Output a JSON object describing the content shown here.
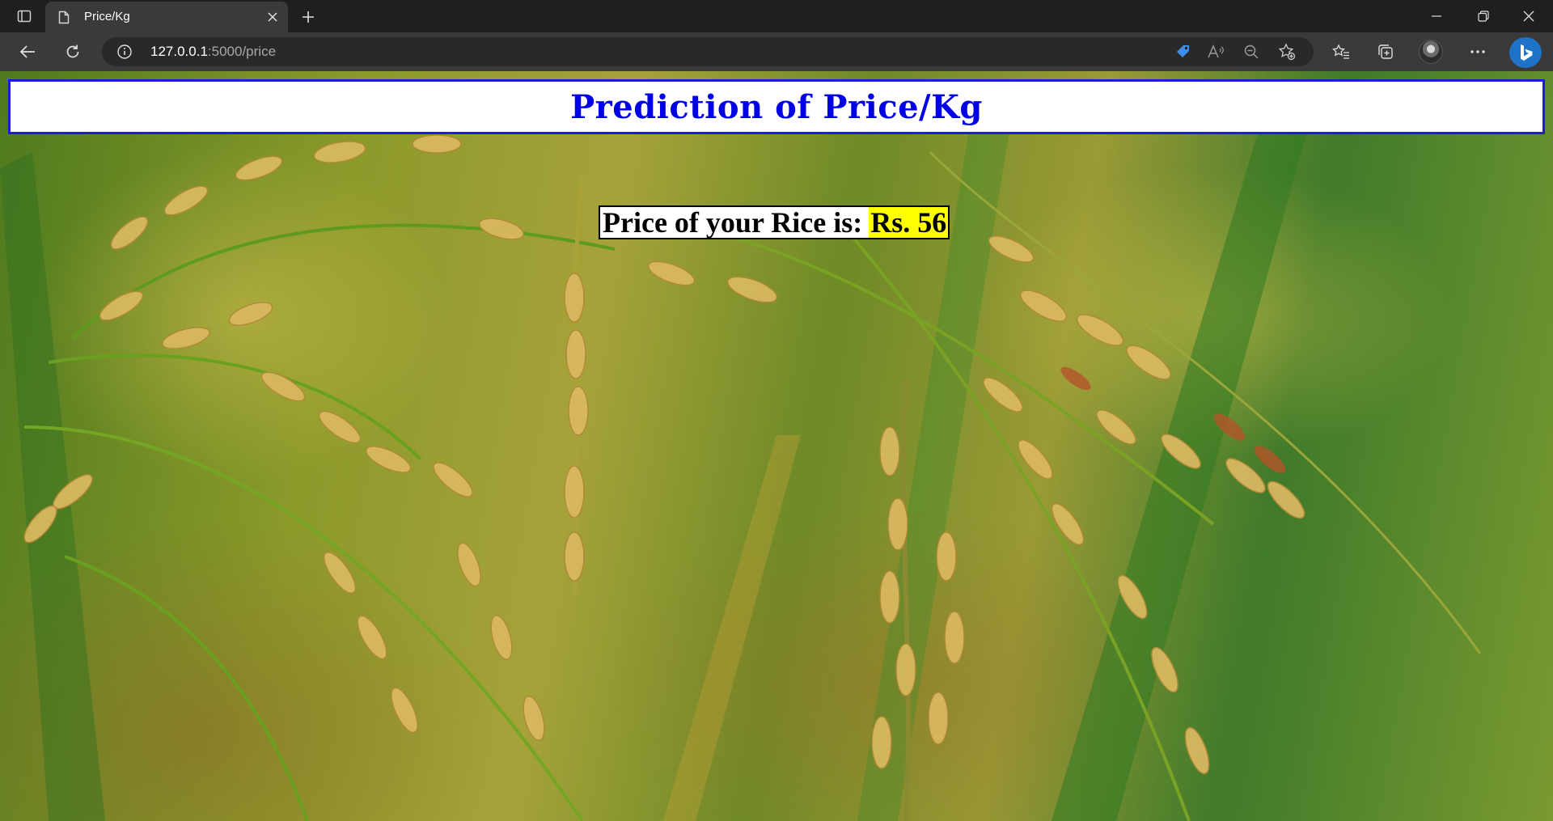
{
  "browser": {
    "tab_title": "Price/Kg",
    "url_host": "127.0.0.1",
    "url_path": ":5000/price"
  },
  "page": {
    "heading": "Prediction of Price/Kg",
    "result_label": "Price of your Rice is:",
    "result_value": "Rs. 56",
    "colors": {
      "heading_text": "#0000e6",
      "heading_border": "#1a1ae0",
      "value_highlight": "#ffff00"
    }
  },
  "icons": {
    "back": "back-arrow-icon",
    "refresh": "refresh-icon",
    "site_info": "info-icon",
    "tracking": "tag-icon",
    "read_aloud": "read-aloud-icon",
    "zoom": "zoom-out-icon",
    "add_favorite": "add-favorite-icon",
    "favorites": "favorites-icon",
    "collections": "collections-icon",
    "more": "more-icon",
    "bing": "bing-icon"
  }
}
